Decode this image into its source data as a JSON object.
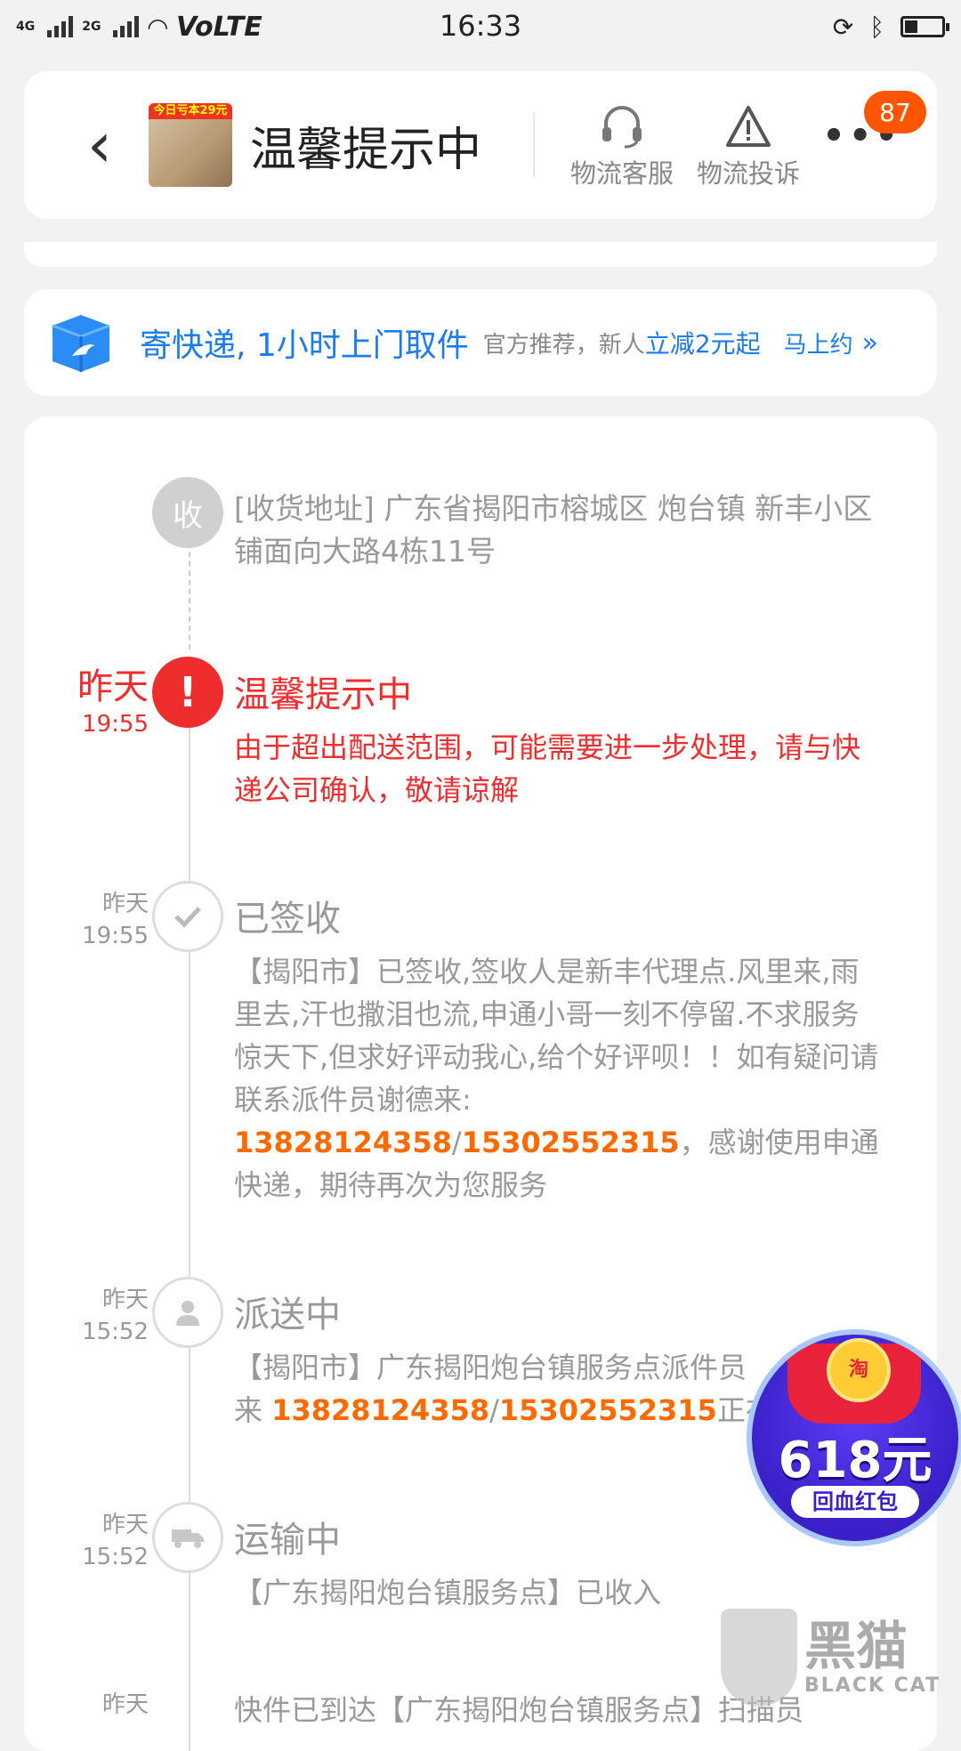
{
  "status_bar": {
    "network": "4G",
    "network2": "2G",
    "volte": "VoLTE",
    "time": "16:33"
  },
  "header": {
    "title": "温馨提示中",
    "thumb_tag": "今日亏本29元",
    "buttons": [
      {
        "label": "物流客服",
        "icon": "headset-icon"
      },
      {
        "label": "物流投诉",
        "icon": "warning-icon"
      }
    ],
    "more_badge": "87"
  },
  "promo": {
    "main": "寄快递, 1小时上门取件",
    "sub": "官方推荐，新人",
    "highlight": "立减2元起",
    "action": "马上约",
    "chevron": "»"
  },
  "timeline": {
    "address_node": "收",
    "address": "[收货地址] 广东省揭阳市榕城区 炮台镇   新丰小区铺面向大路4栋11号",
    "events": [
      {
        "date": "昨天",
        "time": "19:55",
        "title": "温馨提示中",
        "body": "由于超出配送范围，可能需要进一步处理，请与快递公司确认，敬请谅解"
      },
      {
        "date": "昨天",
        "time": "19:55",
        "title": "已签收",
        "body_before": "【揭阳市】已签收,签收人是新丰代理点.风里来,雨里去,汗也撒泪也流,申通小哥一刻不停留.不求服务惊天下,但求好评动我心,给个好评呗！！如有疑问请联系派件员谢德来:",
        "phone1": "13828124358",
        "sep": "/",
        "phone2": "15302552315",
        "body_after": "，感谢使用申通快递，期待再次为您服务"
      },
      {
        "date": "昨天",
        "time": "15:52",
        "title": "派送中",
        "body_before": "【揭阳市】广东揭阳炮台镇服务点派件员",
        "body_mid": "来",
        "phone1": "13828124358",
        "sep": "/",
        "phone2": "15302552315",
        "body_after": "正在为"
      },
      {
        "date": "昨天",
        "time": "15:52",
        "title": "运输中",
        "body": "【广东揭阳炮台镇服务点】已收入"
      },
      {
        "date": "昨天",
        "body": "快件已到达【广东揭阳炮台镇服务点】扫描员"
      }
    ]
  },
  "float_promo": {
    "coin": "淘",
    "amount": "618元",
    "label": "回血红包"
  },
  "watermark": {
    "big": "黑猫",
    "small": "BLACK CAT"
  }
}
